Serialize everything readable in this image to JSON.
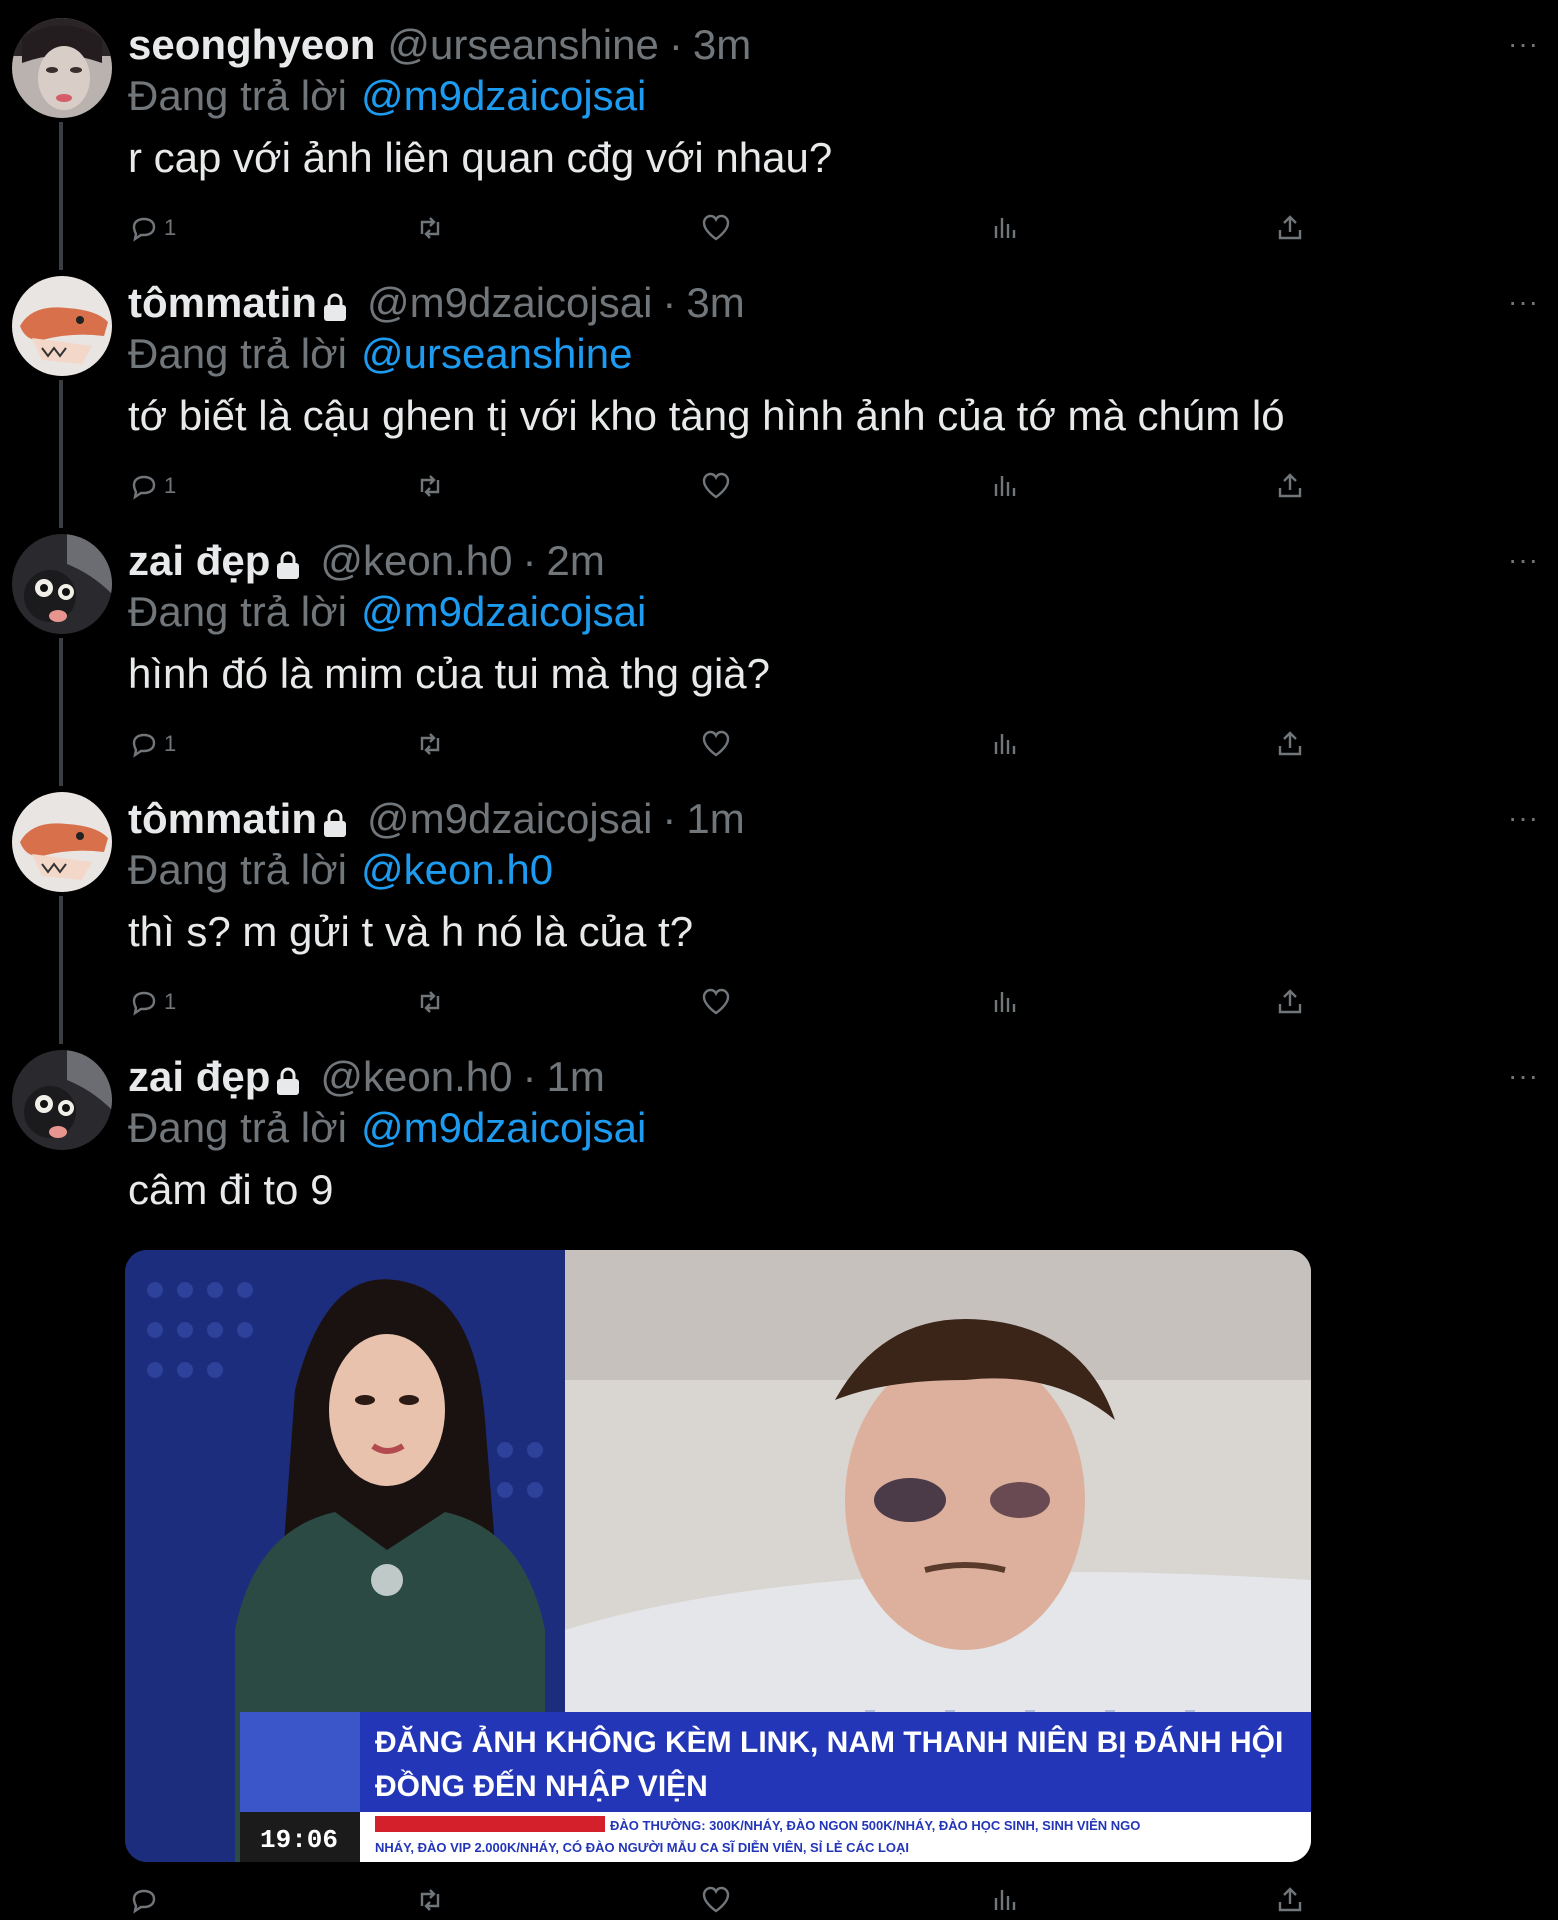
{
  "tweets": [
    {
      "name": "seonghyeon",
      "locked": false,
      "handle": "@urseanshine",
      "sep": "·",
      "time": "3m",
      "reply_label": "Đang trả lời",
      "reply_to": "@m9dzaicojsai",
      "text": "r cap với ảnh liên quan cđg với nhau?",
      "reply_count": "1"
    },
    {
      "name": "tômmatin",
      "locked": true,
      "handle": "@m9dzaicojsai",
      "sep": "·",
      "time": "3m",
      "reply_label": "Đang trả lời",
      "reply_to": "@urseanshine",
      "text": "tớ biết là cậu ghen tị với kho tàng hình ảnh của tớ mà chúm ló",
      "reply_count": "1"
    },
    {
      "name": "zai đẹp",
      "locked": true,
      "handle": "@keon.h0",
      "sep": "·",
      "time": "2m",
      "reply_label": "Đang trả lời",
      "reply_to": "@m9dzaicojsai",
      "text": "hình đó là mim của tui mà thg già?",
      "reply_count": "1"
    },
    {
      "name": "tômmatin",
      "locked": true,
      "handle": "@m9dzaicojsai",
      "sep": "·",
      "time": "1m",
      "reply_label": "Đang trả lời",
      "reply_to": "@keon.h0",
      "text": "thì s? m gửi t và h nó là của t?",
      "reply_count": "1"
    },
    {
      "name": "zai đẹp",
      "locked": true,
      "handle": "@keon.h0",
      "sep": "·",
      "time": "1m",
      "reply_label": "Đang trả lời",
      "reply_to": "@m9dzaicojsai",
      "text": "câm đi to 9",
      "reply_count": ""
    }
  ],
  "more_label": "···",
  "media": {
    "headline_line1": "ĐĂNG ẢNH KHÔNG KÈM LINK, NAM THANH NIÊN BỊ ĐÁNH HỘI",
    "headline_line2": "ĐỒNG ĐẾN NHẬP VIỆN",
    "clock": "19:06",
    "ticker_line1": "ĐÀO THƯỜNG: 300K/NHÁY, ĐÀO NGON 500K/NHÁY, ĐÀO HỌC SINH, SINH VIÊN NGO",
    "ticker_line2": "NHÁY, ĐÀO VIP 2.000K/NHÁY, CÓ ĐÀO NGƯỜI MẪU CA SĨ DIỄN VIÊN, SỈ LẺ CÁC LOẠI"
  },
  "colors": {
    "background": "#000000",
    "text": "#e7e9ea",
    "muted": "#71767b",
    "link": "#1d9bf0"
  }
}
